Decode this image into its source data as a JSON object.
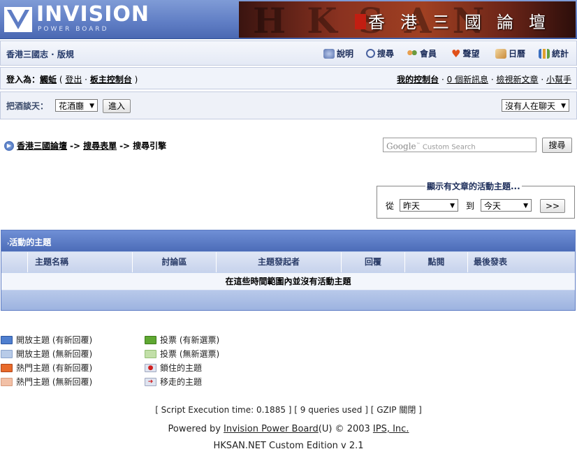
{
  "header": {
    "logo_main": "INVISION",
    "logo_sub": "POWER BOARD",
    "banner_title": "香港三國論壇",
    "banner_bg": "HKSAN"
  },
  "navbar": {
    "forum_title": "香港三國志 · 版規",
    "links": [
      "說明",
      "搜尋",
      "會員",
      "聲望",
      "日曆",
      "統計"
    ]
  },
  "userbar": {
    "login_label": "登入為：",
    "username": "觸蚯",
    "logout": "登出",
    "modcp": "板主控制台",
    "my_controls": "我的控制台",
    "new_messages": "0 個新訊息",
    "view_new": "檢視新文章",
    "helper": "小幫手"
  },
  "chatbar": {
    "label": "把酒談天：",
    "room": "花酒廳",
    "enter": "進入",
    "chat_status": "沒有人在聊天"
  },
  "breadcrumb": {
    "items": [
      "香港三國論壇",
      "搜尋表單",
      "搜尋引擎"
    ],
    "sep": "->"
  },
  "search": {
    "google": "Google",
    "placeholder": "Custom Search",
    "button": "搜尋"
  },
  "date_filter": {
    "legend": "顯示有文章的活動主題...",
    "from_label": "從",
    "from_value": "昨天",
    "to_label": "到",
    "to_value": "今天",
    "go": ">>"
  },
  "table": {
    "title": "活動的主題",
    "columns": [
      "主題名稱",
      "討論區",
      "主題發起者",
      "回覆",
      "點閱",
      "最後發表"
    ],
    "empty": "在這些時間範圍內並沒有活動主題"
  },
  "legend": {
    "left": [
      "開放主題 (有新回覆)",
      "開放主題 (無新回覆)",
      "熱門主題 (有新回覆)",
      "熱門主題 (無新回覆)"
    ],
    "right": [
      "投票 (有新選票)",
      "投票 (無新選票)",
      "鎖住的主題",
      "移走的主題"
    ]
  },
  "footer": {
    "stats": "[ Script Execution time: 0.1885 ]  [ 9 queries used ]  [ GZIP 關閉 ]",
    "powered_prefix": "Powered by ",
    "powered_link": "Invision Power Board",
    "powered_mid": "(U) © 2003  ",
    "ips_link": "IPS, Inc.",
    "edition": "HKSAN.NET Custom Edition v 2.1"
  },
  "colors": {
    "header_blue": "#5f7dc4",
    "table_head": "#4c6cb8",
    "banner_red": "#8a3220"
  }
}
